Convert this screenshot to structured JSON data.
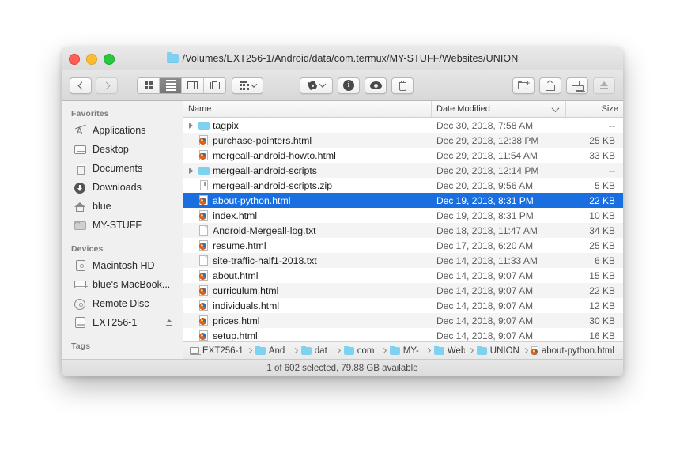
{
  "window": {
    "title": "/Volumes/EXT256-1/Android/data/com.termux/MY-STUFF/Websites/UNION",
    "title_icon": "folder-icon",
    "traffic_lights": [
      "close-button",
      "minimize-button",
      "maximize-button"
    ]
  },
  "toolbar": {
    "back": "back-button",
    "forward": "forward-button",
    "view_modes": [
      {
        "name": "icon-view",
        "active": false
      },
      {
        "name": "list-view",
        "active": true
      },
      {
        "name": "column-view",
        "active": false
      },
      {
        "name": "gallery-view",
        "active": false
      }
    ],
    "arrange": "arrange-by-button",
    "action": "action-gear-button",
    "info": "get-info-button",
    "quicklook": "quick-look-button",
    "delete": "delete-button",
    "new_folder": "new-folder-button",
    "share": "share-button",
    "airdrop": "airdrop-button",
    "eject": "eject-button"
  },
  "sidebar": {
    "sections": [
      {
        "header": "Favorites",
        "items": [
          {
            "label": "Applications",
            "icon": "applications-icon"
          },
          {
            "label": "Desktop",
            "icon": "desktop-icon"
          },
          {
            "label": "Documents",
            "icon": "documents-icon"
          },
          {
            "label": "Downloads",
            "icon": "downloads-icon"
          },
          {
            "label": "blue",
            "icon": "home-icon"
          },
          {
            "label": "MY-STUFF",
            "icon": "folder-icon"
          }
        ]
      },
      {
        "header": "Devices",
        "items": [
          {
            "label": "Macintosh HD",
            "icon": "hard-drive-icon"
          },
          {
            "label": "blue's MacBook...",
            "icon": "laptop-icon"
          },
          {
            "label": "Remote Disc",
            "icon": "disc-icon"
          },
          {
            "label": "EXT256-1",
            "icon": "external-drive-icon",
            "eject": true
          }
        ]
      },
      {
        "header": "Tags",
        "items": []
      }
    ]
  },
  "filelist": {
    "columns": {
      "name": "Name",
      "date_modified": "Date Modified",
      "size": "Size",
      "sort_indicator": "chevron-down-icon"
    },
    "rows": [
      {
        "name": "tagpix",
        "date": "Dec 30, 2018, 7:58 AM",
        "size": "--",
        "icon": "folder-icon",
        "expandable": true,
        "selected": false
      },
      {
        "name": "purchase-pointers.html",
        "date": "Dec 29, 2018, 12:38 PM",
        "size": "25 KB",
        "icon": "html-file-icon",
        "expandable": false,
        "selected": false
      },
      {
        "name": "mergeall-android-howto.html",
        "date": "Dec 29, 2018, 11:54 AM",
        "size": "33 KB",
        "icon": "html-file-icon",
        "expandable": false,
        "selected": false
      },
      {
        "name": "mergeall-android-scripts",
        "date": "Dec 20, 2018, 12:14 PM",
        "size": "--",
        "icon": "folder-icon",
        "expandable": true,
        "selected": false
      },
      {
        "name": "mergeall-android-scripts.zip",
        "date": "Dec 20, 2018, 9:56 AM",
        "size": "5 KB",
        "icon": "zip-file-icon",
        "expandable": false,
        "selected": false
      },
      {
        "name": "about-python.html",
        "date": "Dec 19, 2018, 8:31 PM",
        "size": "22 KB",
        "icon": "html-file-icon",
        "expandable": false,
        "selected": true
      },
      {
        "name": "index.html",
        "date": "Dec 19, 2018, 8:31 PM",
        "size": "10 KB",
        "icon": "html-file-icon",
        "expandable": false,
        "selected": false
      },
      {
        "name": "Android-Mergeall-log.txt",
        "date": "Dec 18, 2018, 11:47 AM",
        "size": "34 KB",
        "icon": "text-file-icon",
        "expandable": false,
        "selected": false
      },
      {
        "name": "resume.html",
        "date": "Dec 17, 2018, 6:20 AM",
        "size": "25 KB",
        "icon": "html-file-icon",
        "expandable": false,
        "selected": false
      },
      {
        "name": "site-traffic-half1-2018.txt",
        "date": "Dec 14, 2018, 11:33 AM",
        "size": "6 KB",
        "icon": "text-file-icon",
        "expandable": false,
        "selected": false
      },
      {
        "name": "about.html",
        "date": "Dec 14, 2018, 9:07 AM",
        "size": "15 KB",
        "icon": "html-file-icon",
        "expandable": false,
        "selected": false
      },
      {
        "name": "curriculum.html",
        "date": "Dec 14, 2018, 9:07 AM",
        "size": "22 KB",
        "icon": "html-file-icon",
        "expandable": false,
        "selected": false
      },
      {
        "name": "individuals.html",
        "date": "Dec 14, 2018, 9:07 AM",
        "size": "12 KB",
        "icon": "html-file-icon",
        "expandable": false,
        "selected": false
      },
      {
        "name": "prices.html",
        "date": "Dec 14, 2018, 9:07 AM",
        "size": "30 KB",
        "icon": "html-file-icon",
        "expandable": false,
        "selected": false
      },
      {
        "name": "setup.html",
        "date": "Dec 14, 2018, 9:07 AM",
        "size": "16 KB",
        "icon": "html-file-icon",
        "expandable": false,
        "selected": false
      }
    ]
  },
  "pathbar": {
    "crumbs": [
      {
        "label": "EXT256-1",
        "icon": "drive-icon"
      },
      {
        "label": "And",
        "icon": "folder-icon"
      },
      {
        "label": "dat",
        "icon": "folder-icon"
      },
      {
        "label": "com",
        "icon": "folder-icon"
      },
      {
        "label": "MY-",
        "icon": "folder-icon"
      },
      {
        "label": "Web",
        "icon": "folder-icon"
      },
      {
        "label": "UNION",
        "icon": "folder-icon"
      },
      {
        "label": "about-python.html",
        "icon": "html-file-icon"
      }
    ]
  },
  "statusbar": {
    "text": "1 of 602 selected, 79.88 GB available"
  },
  "colors": {
    "selection_blue": "#1a6fe0",
    "folder_blue": "#7ed2f0",
    "window_chrome": "#e6e6e6"
  }
}
